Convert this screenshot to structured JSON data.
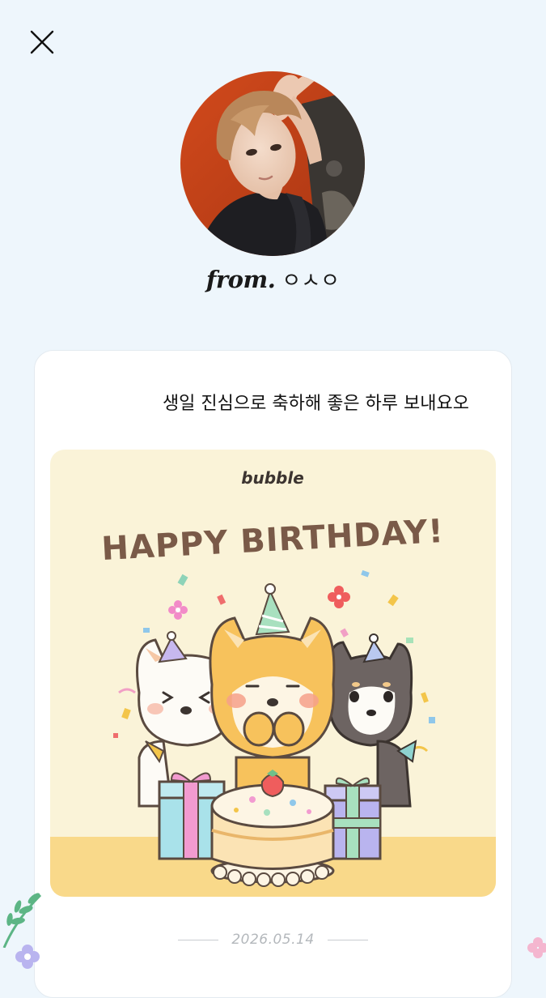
{
  "header": {
    "close_icon": "close-icon"
  },
  "sender": {
    "prefix": "from.",
    "name": "ㅇㅅㅇ"
  },
  "letter": {
    "message": "생일 진심으로 축하해 좋은 하루 보내요오",
    "sticker": {
      "brand": "bubble",
      "headline": "HAPPY BIRTHDAY!"
    },
    "date": "2026.05.14"
  },
  "colors": {
    "background": "#eef6fc",
    "card": "#ffffff",
    "sticker_bg": "#faf3d8",
    "headline": "#7a5a48",
    "date": "#b4b8bc"
  }
}
